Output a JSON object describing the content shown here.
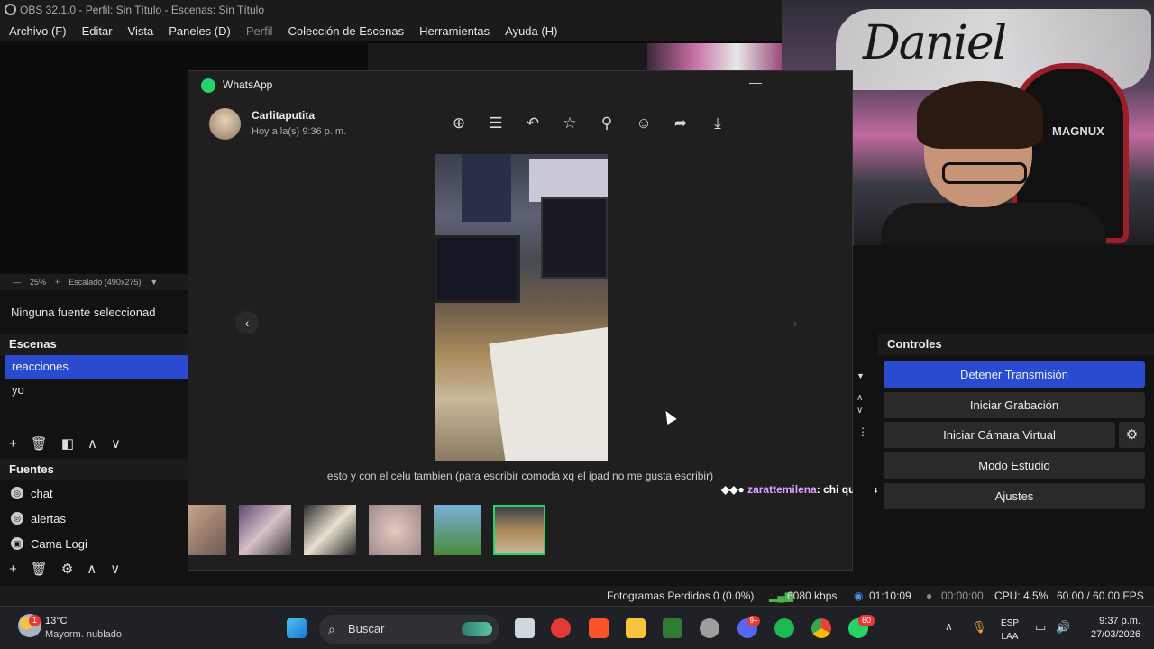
{
  "window": {
    "title": "OBS 32.1.0 - Perfil: Sin Título - Escenas: Sin Título"
  },
  "menu": [
    "Archivo (F)",
    "Editar",
    "Vista",
    "Paneles (D)",
    "Perfil",
    "Colección de Escenas",
    "Herramientas",
    "Ayuda (H)"
  ],
  "zoombar": {
    "zoom": "25%",
    "scale": "Escalado (490x275)"
  },
  "no_source": "Ninguna fuente seleccionad",
  "scenes": {
    "title": "Escenas",
    "items": [
      "reacciones",
      "yo"
    ]
  },
  "sources": {
    "title": "Fuentes",
    "items": [
      "chat",
      "alertas",
      "Cama Logi"
    ]
  },
  "webcam": {
    "graffiti_text": "Daniel",
    "chair_text": "MAGNUX"
  },
  "whatsapp": {
    "app_title": "WhatsApp",
    "contact_name": "Carlitaputita",
    "contact_time": "Hoy a la(s) 9:36 p. m.",
    "caption": "esto y con el celu tambien (para escribir comoda xq el ipad no me gusta escribir)"
  },
  "chat_overlay": {
    "user": "zarattemilena",
    "message": ": chi queres ver al pv"
  },
  "controls": {
    "title": "Controles",
    "buttons": [
      "Detener Transmisión",
      "Iniciar Grabación",
      "Iniciar Cámara Virtual",
      "Modo Estudio",
      "Ajustes"
    ]
  },
  "status": {
    "dropped": "Fotogramas Perdidos 0 (0.0%)",
    "bitrate": "6080 kbps",
    "stream_time": "01:10:09",
    "rec_time": "00:00:00",
    "cpu": "CPU: 4.5%",
    "fps": "60.00 / 60.00 FPS"
  },
  "taskbar": {
    "weather_temp": "13°C",
    "weather_desc": "Mayorm. nublado",
    "search_label": "Buscar",
    "lang": "ESP",
    "region": "LAA",
    "time": "9:37 p.m.",
    "date": "27/03/2026",
    "whatsapp_badge": "60",
    "discord_badge": "9+",
    "weather_badge": "1"
  }
}
